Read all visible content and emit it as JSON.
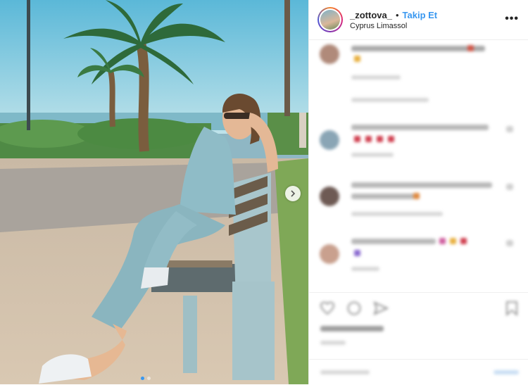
{
  "header": {
    "username": "_zottova_",
    "separator": "•",
    "follow_label": "Takip Et",
    "location": "Cyprus Limassol",
    "more_label": "•••"
  },
  "colors": {
    "accent": "#3897f0",
    "text": "#262626",
    "border": "#efefef"
  },
  "icons": {
    "more": "more-options-icon",
    "like": "heart-icon",
    "comment": "comment-icon",
    "share": "share-icon",
    "save": "bookmark-icon",
    "next": "chevron-right-icon"
  },
  "carousel": {
    "total_dots": 2,
    "active_index": 0
  }
}
